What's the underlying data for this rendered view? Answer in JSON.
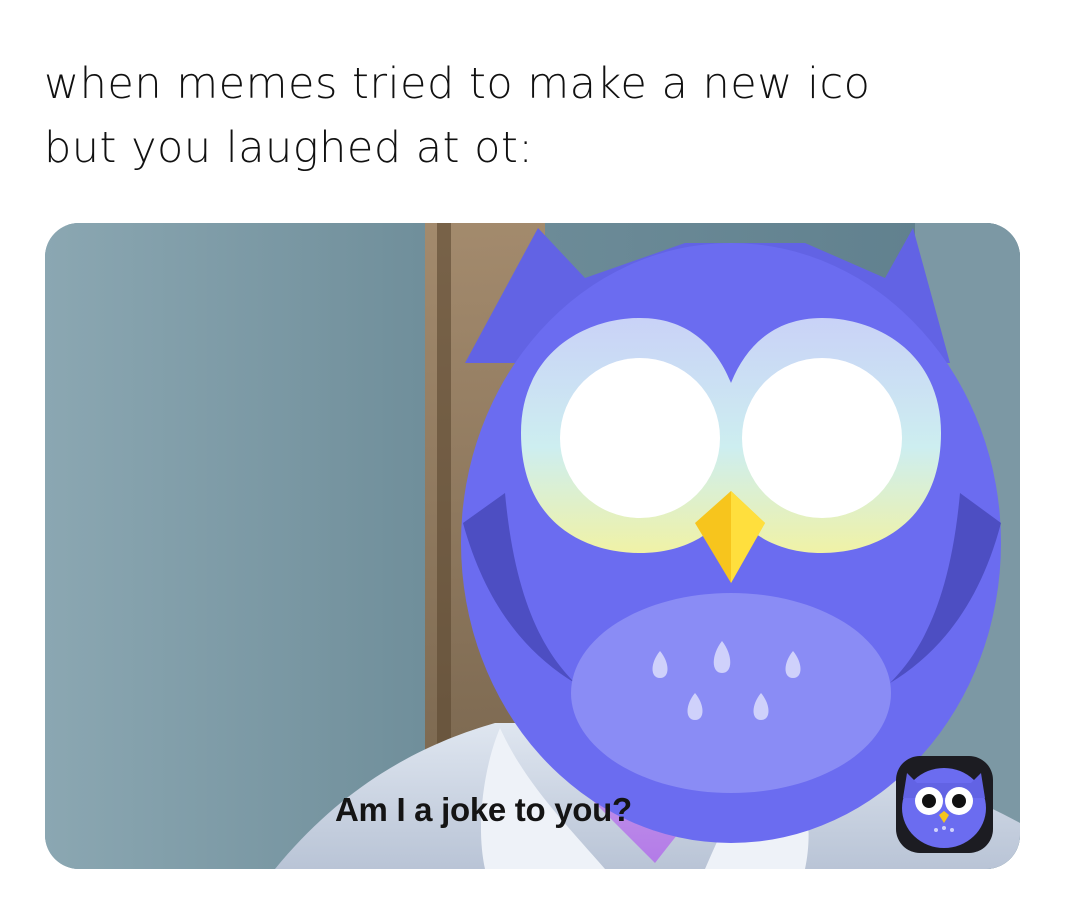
{
  "caption": {
    "line1": "when memes tried to make a new ico",
    "line2": "but you laughed at ot:"
  },
  "meme": {
    "text": "Am I a joke to you?",
    "mascot_icon": "owl-face-icon",
    "badge_icon": "owl-app-icon",
    "colors": {
      "owl_body": "#6b6cf0",
      "owl_belly": "#8a8cf5",
      "beak": "#f7c51d",
      "app_icon_bg": "#1c1c22"
    }
  }
}
